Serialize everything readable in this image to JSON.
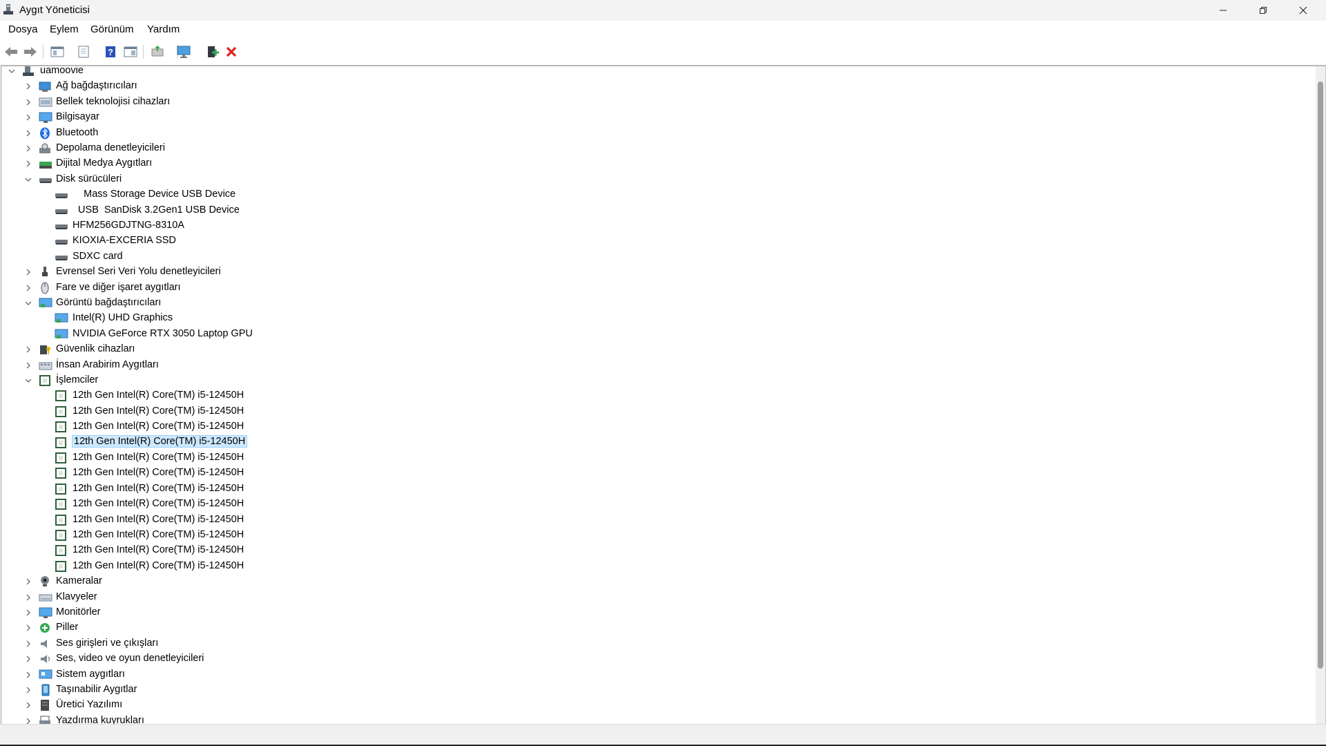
{
  "window": {
    "title": "Aygıt Yöneticisi"
  },
  "menu": [
    "Dosya",
    "Eylem",
    "Görünüm",
    "Yardım"
  ],
  "toolbar": [
    "back-icon",
    "forward-icon",
    "show-hide-tree-icon",
    "properties-icon",
    "help-icon",
    "view-icon",
    "update-driver-icon",
    "scan-hardware-icon",
    "add-driver-icon",
    "uninstall-icon"
  ],
  "tree": {
    "root": "uamoovie",
    "categories": [
      {
        "label": "Ağ bağdaştırıcıları",
        "icon": "network-adapter-icon",
        "expanded": false
      },
      {
        "label": "Bellek teknolojisi cihazları",
        "icon": "memory-device-icon",
        "expanded": false
      },
      {
        "label": "Bilgisayar",
        "icon": "computer-icon",
        "expanded": false
      },
      {
        "label": "Bluetooth",
        "icon": "bluetooth-icon",
        "expanded": false
      },
      {
        "label": "Depolama denetleyicileri",
        "icon": "storage-controller-icon",
        "expanded": false
      },
      {
        "label": "Dijital Medya Aygıtları",
        "icon": "digital-media-icon",
        "expanded": false
      },
      {
        "label": "Disk sürücüleri",
        "icon": "disk-drive-icon",
        "expanded": true,
        "children": [
          "    Mass Storage Device USB Device",
          "  USB  SanDisk 3.2Gen1 USB Device",
          "HFM256GDJTNG-8310A",
          "KIOXIA-EXCERIA SSD",
          "SDXC card"
        ]
      },
      {
        "label": "Evrensel Seri Veri Yolu denetleyicileri",
        "icon": "usb-controller-icon",
        "expanded": false
      },
      {
        "label": "Fare ve diğer işaret aygıtları",
        "icon": "mouse-icon",
        "expanded": false
      },
      {
        "label": "Görüntü bağdaştırıcıları",
        "icon": "display-adapter-icon",
        "expanded": true,
        "children": [
          "Intel(R) UHD Graphics",
          "NVIDIA GeForce RTX 3050 Laptop GPU"
        ]
      },
      {
        "label": "Güvenlik cihazları",
        "icon": "security-device-icon",
        "expanded": false
      },
      {
        "label": "İnsan Arabirim Aygıtları",
        "icon": "hid-icon",
        "expanded": false
      },
      {
        "label": "İşlemciler",
        "icon": "processor-icon",
        "expanded": true,
        "children": [
          "12th Gen Intel(R) Core(TM) i5-12450H",
          "12th Gen Intel(R) Core(TM) i5-12450H",
          "12th Gen Intel(R) Core(TM) i5-12450H",
          "12th Gen Intel(R) Core(TM) i5-12450H",
          "12th Gen Intel(R) Core(TM) i5-12450H",
          "12th Gen Intel(R) Core(TM) i5-12450H",
          "12th Gen Intel(R) Core(TM) i5-12450H",
          "12th Gen Intel(R) Core(TM) i5-12450H",
          "12th Gen Intel(R) Core(TM) i5-12450H",
          "12th Gen Intel(R) Core(TM) i5-12450H",
          "12th Gen Intel(R) Core(TM) i5-12450H",
          "12th Gen Intel(R) Core(TM) i5-12450H"
        ],
        "selected_child": 3
      },
      {
        "label": "Kameralar",
        "icon": "camera-icon",
        "expanded": false
      },
      {
        "label": "Klavyeler",
        "icon": "keyboard-icon",
        "expanded": false
      },
      {
        "label": "Monitörler",
        "icon": "monitor-icon",
        "expanded": false
      },
      {
        "label": "Piller",
        "icon": "battery-icon",
        "expanded": false
      },
      {
        "label": "Ses girişleri ve çıkışları",
        "icon": "audio-io-icon",
        "expanded": false
      },
      {
        "label": "Ses, video ve oyun denetleyicileri",
        "icon": "sound-controller-icon",
        "expanded": false
      },
      {
        "label": "Sistem aygıtları",
        "icon": "system-device-icon",
        "expanded": false
      },
      {
        "label": "Taşınabilir Aygıtlar",
        "icon": "portable-device-icon",
        "expanded": false
      },
      {
        "label": "Üretici Yazılımı",
        "icon": "firmware-icon",
        "expanded": false
      },
      {
        "label": "Yazdırma kuyrukları",
        "icon": "print-queue-icon",
        "expanded": false
      }
    ]
  },
  "colors": {
    "selection_bg": "#cde8ff",
    "selection_border": "#99d1ff",
    "titlebar_bg": "#f3f3f3"
  }
}
